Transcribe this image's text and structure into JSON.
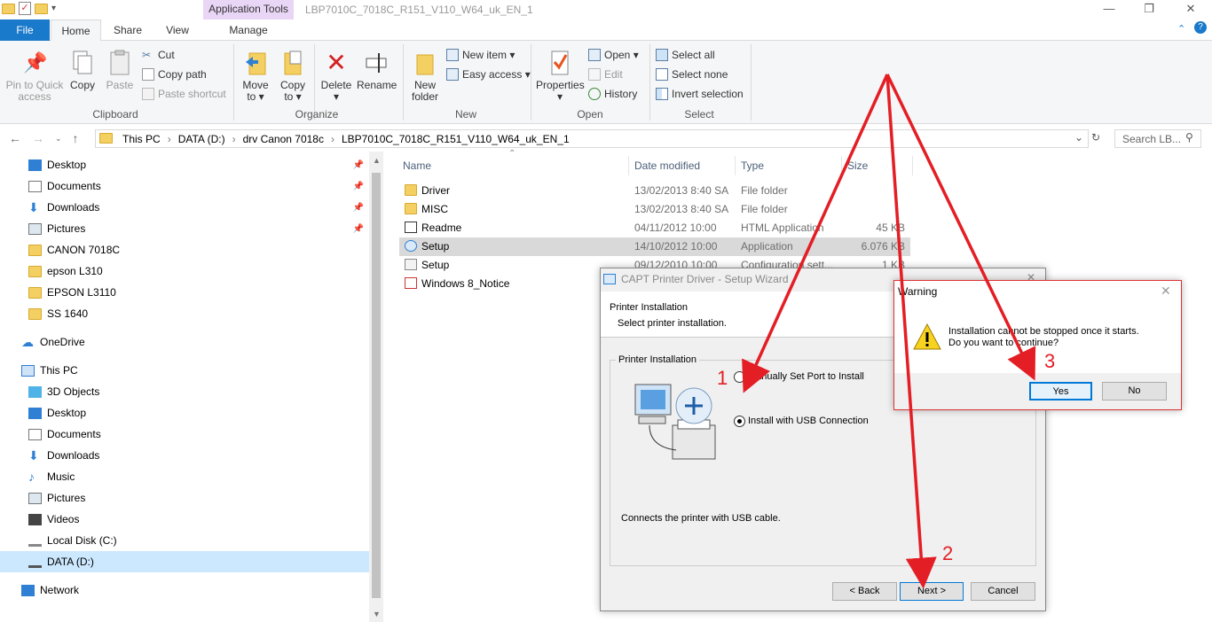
{
  "titlebar": {
    "app_tools": "Application Tools",
    "window_title": "LBP7010C_7018C_R151_V110_W64_uk_EN_1",
    "min": "—",
    "max": "❐",
    "close": "✕"
  },
  "tabs": {
    "file": "File",
    "home": "Home",
    "share": "Share",
    "view": "View",
    "manage": "Manage"
  },
  "ribbon": {
    "pin_quick_access": [
      "Pin to Quick",
      "access"
    ],
    "copy": "Copy",
    "paste": "Paste",
    "cut": "Cut",
    "copy_path": "Copy path",
    "paste_shortcut": "Paste shortcut",
    "move_to": [
      "Move",
      "to ▾"
    ],
    "copy_to": [
      "Copy",
      "to ▾"
    ],
    "delete": [
      "Delete",
      "▾"
    ],
    "rename": "Rename",
    "new_folder": [
      "New",
      "folder"
    ],
    "new_item": "New item ▾",
    "easy_access": "Easy access ▾",
    "properties": [
      "Properties",
      "▾"
    ],
    "open": "Open ▾",
    "edit": "Edit",
    "history": "History",
    "select_all": "Select all",
    "select_none": "Select none",
    "invert_selection": "Invert selection",
    "groups": {
      "clipboard": "Clipboard",
      "organize": "Organize",
      "new": "New",
      "open": "Open",
      "select": "Select"
    }
  },
  "address": {
    "crumbs": [
      "This PC",
      "DATA (D:)",
      "drv Canon 7018c",
      "LBP7010C_7018C_R151_V110_W64_uk_EN_1"
    ],
    "search_placeholder": "Search LB..."
  },
  "nav": {
    "quick": [
      "Desktop",
      "Documents",
      "Downloads",
      "Pictures",
      "CANON 7018C",
      "epson L310",
      "EPSON L3110",
      "SS 1640"
    ],
    "onedrive": "OneDrive",
    "thispc": "This PC",
    "pc_items": [
      "3D Objects",
      "Desktop",
      "Documents",
      "Downloads",
      "Music",
      "Pictures",
      "Videos",
      "Local Disk (C:)",
      "DATA (D:)"
    ],
    "network": "Network"
  },
  "columns": {
    "name": "Name",
    "date": "Date modified",
    "type": "Type",
    "size": "Size"
  },
  "files": [
    {
      "name": "Driver",
      "date": "13/02/2013 8:40 SA",
      "type": "File folder",
      "size": ""
    },
    {
      "name": "MISC",
      "date": "13/02/2013 8:40 SA",
      "type": "File folder",
      "size": ""
    },
    {
      "name": "Readme",
      "date": "04/11/2012 10:00",
      "type": "HTML Application",
      "size": "45 KB"
    },
    {
      "name": "Setup",
      "date": "14/10/2012 10:00",
      "type": "Application",
      "size": "6.076 KB"
    },
    {
      "name": "Setup",
      "date": "09/12/2010 10:00",
      "type": "Configuration sett...",
      "size": "1 KB"
    },
    {
      "name": "Windows 8_Notice",
      "date": "",
      "type": "",
      "size": ""
    }
  ],
  "wizard": {
    "title": "CAPT Printer Driver - Setup Wizard",
    "heading": "Printer Installation",
    "subheading": "Select printer installation.",
    "group_label": "Printer Installation",
    "option_manual": "Manually Set Port to Install",
    "option_usb": "Install with USB Connection",
    "description": "Connects the printer with USB cable.",
    "back": "< Back",
    "next": "Next >",
    "cancel": "Cancel"
  },
  "warning": {
    "title": "Warning",
    "line1": "Installation cannot be stopped once it starts.",
    "line2": "Do you want to continue?",
    "yes": "Yes",
    "no": "No"
  },
  "annotations": {
    "one": "1",
    "two": "2",
    "three": "3"
  },
  "colors": {
    "accent": "#1979ca",
    "annotation": "#e31e24",
    "selection": "#cce8ff",
    "app_tools_tab": "#e9d5f5"
  }
}
